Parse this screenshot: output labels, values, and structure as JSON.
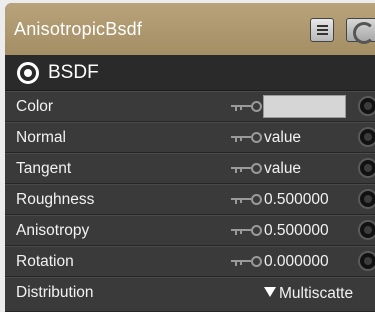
{
  "node": {
    "title": "AnisotropicBsdf",
    "header_buttons": [
      {
        "icon": "list-icon"
      },
      {
        "icon": "preview-sphere-icon"
      }
    ],
    "section": {
      "label": "BSDF",
      "icon": "bsdf-output-icon"
    }
  },
  "params": [
    {
      "label": "Color",
      "value": "",
      "type": "color",
      "color": "#d6d6d6"
    },
    {
      "label": "Normal",
      "value": "value"
    },
    {
      "label": "Tangent",
      "value": "value"
    },
    {
      "label": "Roughness",
      "value": "0.500000"
    },
    {
      "label": "Anisotropy",
      "value": "0.500000"
    },
    {
      "label": "Rotation",
      "value": "0.000000"
    },
    {
      "label": "Distribution",
      "value": "Multiscatte",
      "type": "dropdown"
    }
  ],
  "colors": {
    "header": "#b09a70",
    "panel": "#2f2f2f",
    "row": "#3a3a3a",
    "text": "#f2f2f2"
  }
}
